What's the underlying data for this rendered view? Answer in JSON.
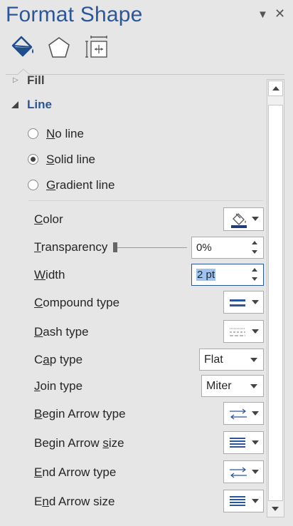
{
  "header": {
    "title": "Format Shape",
    "dropdown_glyph": "▼",
    "close_glyph": "✕"
  },
  "tabs": [
    {
      "name": "fill-line",
      "icon": "paint-bucket-icon",
      "active": true
    },
    {
      "name": "effects",
      "icon": "pentagon-icon",
      "active": false
    },
    {
      "name": "size-properties",
      "icon": "size-properties-icon",
      "active": false
    }
  ],
  "sections": {
    "fill": {
      "label": "Fill"
    },
    "line": {
      "label": "Line"
    }
  },
  "line_options": {
    "no_line": {
      "label_accel": "N",
      "label_rest": "o line"
    },
    "solid_line": {
      "label_accel": "S",
      "label_rest": "olid line"
    },
    "gradient_line": {
      "label_accel": "G",
      "label_rest": "radient line"
    }
  },
  "properties": {
    "color": {
      "accel": "C",
      "rest": "olor"
    },
    "transparency": {
      "accel": "T",
      "rest": "ransparency",
      "value": "0%",
      "slider_fraction": 0.0
    },
    "width": {
      "accel": "W",
      "rest": "idth",
      "value": "2 pt"
    },
    "compound": {
      "accel": "C",
      "rest": "ompound type"
    },
    "dash": {
      "accel": "D",
      "rest": "ash type"
    },
    "cap": {
      "pre": "C",
      "accel": "a",
      "rest": "p type",
      "value": "Flat"
    },
    "join": {
      "accel": "J",
      "rest": "oin type",
      "value": "Miter"
    },
    "begin_arrow_type": {
      "pre": "",
      "accel": "B",
      "rest": "egin Arrow type"
    },
    "begin_arrow_size": {
      "pre": "Begin Arrow ",
      "accel": "s",
      "rest": "ize"
    },
    "end_arrow_type": {
      "pre": "",
      "accel": "E",
      "rest": "nd Arrow type"
    },
    "end_arrow_size": {
      "pre": "E",
      "accel": "n",
      "rest": "d Arrow size"
    }
  },
  "colors": {
    "accent": "#2b579a",
    "line_color": "#1f3d7a",
    "selection": "#9ec3f0"
  }
}
